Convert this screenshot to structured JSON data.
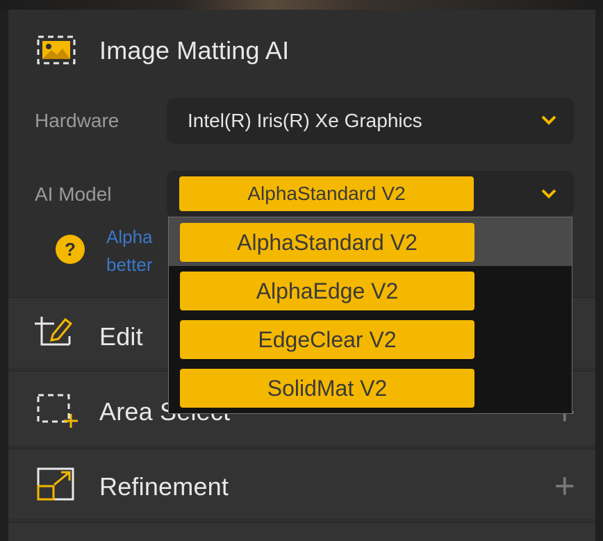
{
  "matting": {
    "title": "Image Matting AI",
    "hardware_label": "Hardware",
    "hardware_value": "Intel(R) Iris(R) Xe Graphics",
    "ai_model_label": "AI Model",
    "ai_model_value": "AlphaStandard  V2",
    "help_line1": "Alpha",
    "help_line2": "better",
    "help_icon": "?"
  },
  "dropdown": {
    "options": [
      "AlphaStandard  V2",
      "AlphaEdge  V2",
      "EdgeClear  V2",
      "SolidMat  V2"
    ],
    "highlighted": "AlphaStandard  V2"
  },
  "sections": {
    "edit": "Edit",
    "area_select": "Area Select",
    "refinement": "Refinement",
    "plus_symbol": "+"
  },
  "colors": {
    "accent": "#f5b800",
    "link": "#3a78c8",
    "panel": "#2e2e2e"
  }
}
